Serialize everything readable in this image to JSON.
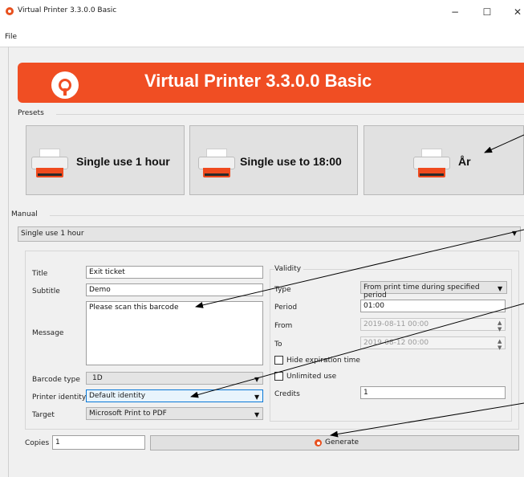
{
  "window": {
    "title": "Virtual Printer 3.3.0.0 Basic",
    "minimize": "−",
    "maximize": "☐",
    "close": "✕"
  },
  "menu": {
    "file": "File"
  },
  "banner": {
    "title": "Virtual Printer 3.3.0.0 Basic"
  },
  "presets": {
    "label": "Presets",
    "tiles": [
      {
        "label": "Single use 1 hour"
      },
      {
        "label": "Single use to 18:00"
      },
      {
        "label": "År"
      }
    ]
  },
  "manual": {
    "label": "Manual",
    "selected_preset": "Single use 1 hour",
    "title_label": "Title",
    "title_value": "Exit ticket",
    "subtitle_label": "Subtitle",
    "subtitle_value": "Demo",
    "message_label": "Message",
    "message_value": "Please scan this barcode",
    "barcode_type_label": "Barcode type",
    "barcode_type_value": "1D",
    "printer_identity_label": "Printer identity",
    "printer_identity_value": "Default identity",
    "target_label": "Target",
    "target_value": "Microsoft Print to PDF"
  },
  "validity": {
    "label": "Validity",
    "type_label": "Type",
    "type_value": "From print time during specified period",
    "period_label": "Period",
    "period_value": "01:00",
    "from_label": "From",
    "from_value": "2019-08-11 00:00",
    "to_label": "To",
    "to_value": "2019-08-12 00:00",
    "hide_expiration_label": "Hide expiration time",
    "hide_expiration_checked": false,
    "unlimited_use_label": "Unlimited use",
    "unlimited_use_checked": false,
    "credits_label": "Credits",
    "credits_value": "1"
  },
  "footer": {
    "copies_label": "Copies",
    "copies_value": "1",
    "generate_label": "Generate"
  },
  "colors": {
    "brand": "#f04e23",
    "focus_border": "#0a78d7"
  }
}
